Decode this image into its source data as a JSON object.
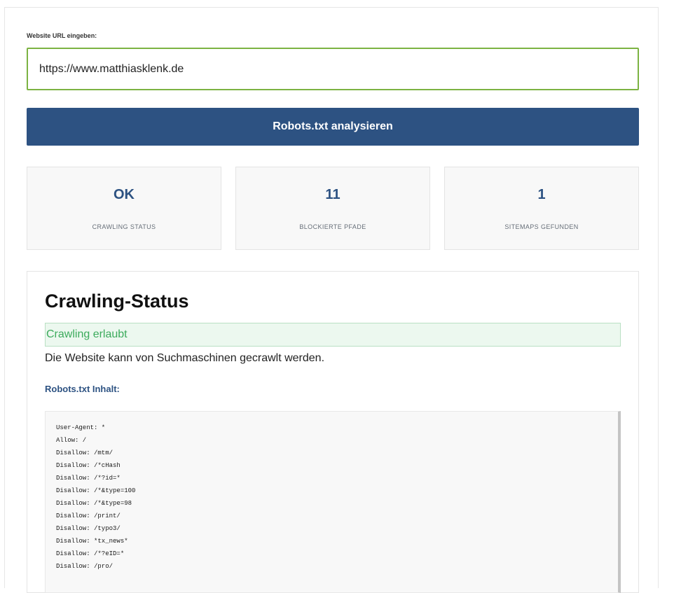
{
  "url_form": {
    "label": "Website URL eingeben:",
    "value": "https://www.matthiasklenk.de"
  },
  "analyze_button": {
    "label": "Robots.txt analysieren"
  },
  "stats": [
    {
      "value": "OK",
      "label": "CRAWLING STATUS"
    },
    {
      "value": "11",
      "label": "BLOCKIERTE PFADE"
    },
    {
      "value": "1",
      "label": "SITEMAPS GEFUNDEN"
    }
  ],
  "status_panel": {
    "title": "Crawling-Status",
    "alert": "Crawling erlaubt",
    "description": "Die Website kann von Suchmaschinen gecrawlt werden.",
    "content_heading": "Robots.txt Inhalt:",
    "robots_lines": [
      "User-Agent: *",
      "Allow: /",
      "Disallow: /mtm/",
      "Disallow: /*cHash",
      "Disallow: /*?id=*",
      "Disallow: /*&type=100",
      "Disallow: /*&type=98",
      "Disallow: /print/",
      "Disallow: /typo3/",
      "Disallow: *tx_news*",
      "Disallow: /*?eID=*",
      "Disallow: /pro/"
    ]
  },
  "colors": {
    "primary": "#2d5282",
    "input_border": "#7cb342",
    "success_text": "#3cab5c",
    "success_bg": "#ecf8ef"
  }
}
